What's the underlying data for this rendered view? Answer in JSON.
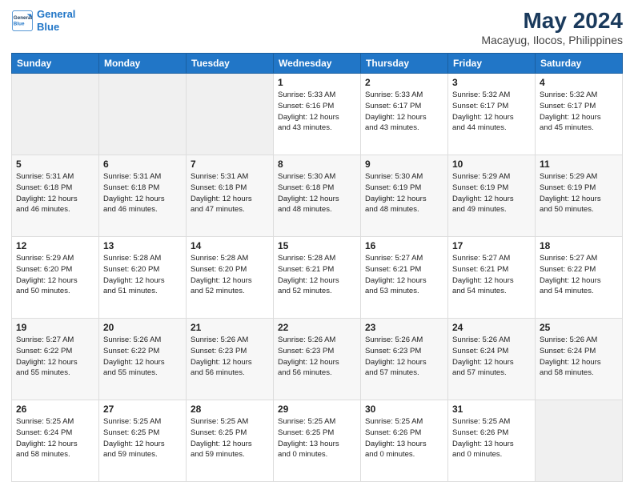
{
  "logo": {
    "line1": "General",
    "line2": "Blue"
  },
  "title": "May 2024",
  "subtitle": "Macayug, Ilocos, Philippines",
  "weekdays": [
    "Sunday",
    "Monday",
    "Tuesday",
    "Wednesday",
    "Thursday",
    "Friday",
    "Saturday"
  ],
  "weeks": [
    [
      {
        "day": "",
        "info": ""
      },
      {
        "day": "",
        "info": ""
      },
      {
        "day": "",
        "info": ""
      },
      {
        "day": "1",
        "info": "Sunrise: 5:33 AM\nSunset: 6:16 PM\nDaylight: 12 hours\nand 43 minutes."
      },
      {
        "day": "2",
        "info": "Sunrise: 5:33 AM\nSunset: 6:17 PM\nDaylight: 12 hours\nand 43 minutes."
      },
      {
        "day": "3",
        "info": "Sunrise: 5:32 AM\nSunset: 6:17 PM\nDaylight: 12 hours\nand 44 minutes."
      },
      {
        "day": "4",
        "info": "Sunrise: 5:32 AM\nSunset: 6:17 PM\nDaylight: 12 hours\nand 45 minutes."
      }
    ],
    [
      {
        "day": "5",
        "info": "Sunrise: 5:31 AM\nSunset: 6:18 PM\nDaylight: 12 hours\nand 46 minutes."
      },
      {
        "day": "6",
        "info": "Sunrise: 5:31 AM\nSunset: 6:18 PM\nDaylight: 12 hours\nand 46 minutes."
      },
      {
        "day": "7",
        "info": "Sunrise: 5:31 AM\nSunset: 6:18 PM\nDaylight: 12 hours\nand 47 minutes."
      },
      {
        "day": "8",
        "info": "Sunrise: 5:30 AM\nSunset: 6:18 PM\nDaylight: 12 hours\nand 48 minutes."
      },
      {
        "day": "9",
        "info": "Sunrise: 5:30 AM\nSunset: 6:19 PM\nDaylight: 12 hours\nand 48 minutes."
      },
      {
        "day": "10",
        "info": "Sunrise: 5:29 AM\nSunset: 6:19 PM\nDaylight: 12 hours\nand 49 minutes."
      },
      {
        "day": "11",
        "info": "Sunrise: 5:29 AM\nSunset: 6:19 PM\nDaylight: 12 hours\nand 50 minutes."
      }
    ],
    [
      {
        "day": "12",
        "info": "Sunrise: 5:29 AM\nSunset: 6:20 PM\nDaylight: 12 hours\nand 50 minutes."
      },
      {
        "day": "13",
        "info": "Sunrise: 5:28 AM\nSunset: 6:20 PM\nDaylight: 12 hours\nand 51 minutes."
      },
      {
        "day": "14",
        "info": "Sunrise: 5:28 AM\nSunset: 6:20 PM\nDaylight: 12 hours\nand 52 minutes."
      },
      {
        "day": "15",
        "info": "Sunrise: 5:28 AM\nSunset: 6:21 PM\nDaylight: 12 hours\nand 52 minutes."
      },
      {
        "day": "16",
        "info": "Sunrise: 5:27 AM\nSunset: 6:21 PM\nDaylight: 12 hours\nand 53 minutes."
      },
      {
        "day": "17",
        "info": "Sunrise: 5:27 AM\nSunset: 6:21 PM\nDaylight: 12 hours\nand 54 minutes."
      },
      {
        "day": "18",
        "info": "Sunrise: 5:27 AM\nSunset: 6:22 PM\nDaylight: 12 hours\nand 54 minutes."
      }
    ],
    [
      {
        "day": "19",
        "info": "Sunrise: 5:27 AM\nSunset: 6:22 PM\nDaylight: 12 hours\nand 55 minutes."
      },
      {
        "day": "20",
        "info": "Sunrise: 5:26 AM\nSunset: 6:22 PM\nDaylight: 12 hours\nand 55 minutes."
      },
      {
        "day": "21",
        "info": "Sunrise: 5:26 AM\nSunset: 6:23 PM\nDaylight: 12 hours\nand 56 minutes."
      },
      {
        "day": "22",
        "info": "Sunrise: 5:26 AM\nSunset: 6:23 PM\nDaylight: 12 hours\nand 56 minutes."
      },
      {
        "day": "23",
        "info": "Sunrise: 5:26 AM\nSunset: 6:23 PM\nDaylight: 12 hours\nand 57 minutes."
      },
      {
        "day": "24",
        "info": "Sunrise: 5:26 AM\nSunset: 6:24 PM\nDaylight: 12 hours\nand 57 minutes."
      },
      {
        "day": "25",
        "info": "Sunrise: 5:26 AM\nSunset: 6:24 PM\nDaylight: 12 hours\nand 58 minutes."
      }
    ],
    [
      {
        "day": "26",
        "info": "Sunrise: 5:25 AM\nSunset: 6:24 PM\nDaylight: 12 hours\nand 58 minutes."
      },
      {
        "day": "27",
        "info": "Sunrise: 5:25 AM\nSunset: 6:25 PM\nDaylight: 12 hours\nand 59 minutes."
      },
      {
        "day": "28",
        "info": "Sunrise: 5:25 AM\nSunset: 6:25 PM\nDaylight: 12 hours\nand 59 minutes."
      },
      {
        "day": "29",
        "info": "Sunrise: 5:25 AM\nSunset: 6:25 PM\nDaylight: 13 hours\nand 0 minutes."
      },
      {
        "day": "30",
        "info": "Sunrise: 5:25 AM\nSunset: 6:26 PM\nDaylight: 13 hours\nand 0 minutes."
      },
      {
        "day": "31",
        "info": "Sunrise: 5:25 AM\nSunset: 6:26 PM\nDaylight: 13 hours\nand 0 minutes."
      },
      {
        "day": "",
        "info": ""
      }
    ]
  ]
}
